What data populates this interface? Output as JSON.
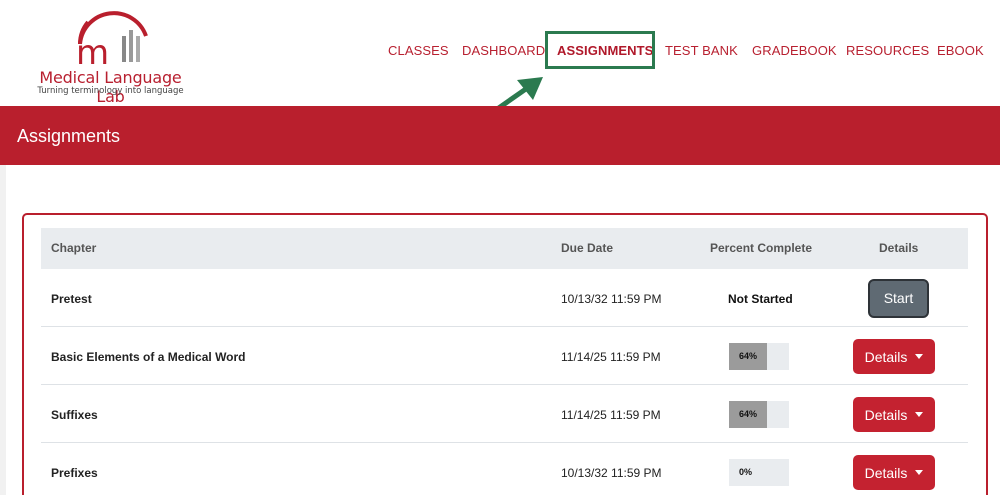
{
  "brand": {
    "name": "Medical Language Lab",
    "tagline": "Turning terminology into language",
    "color": "#b91f2d"
  },
  "nav": {
    "items": [
      "CLASSES",
      "DASHBOARD",
      "ASSIGNMENTS",
      "TEST BANK",
      "GRADEBOOK",
      "RESOURCES",
      "EBOOK"
    ],
    "active": "ASSIGNMENTS"
  },
  "annotation": {
    "highlight_color": "#2b7a4f",
    "arrow_icon": "arrow-up-right-icon"
  },
  "page": {
    "title": "Assignments"
  },
  "table": {
    "headers": {
      "chapter": "Chapter",
      "due": "Due Date",
      "percent": "Percent Complete",
      "details": "Details"
    },
    "rows": [
      {
        "chapter": "Pretest",
        "due": "10/13/32 11:59 PM",
        "status": "Not Started",
        "action": "Start"
      },
      {
        "chapter": "Basic Elements of a Medical Word",
        "due": "11/14/25 11:59 PM",
        "percent": 0.64,
        "percent_label": "64%",
        "action": "Details"
      },
      {
        "chapter": "Suffixes",
        "due": "11/14/25 11:59 PM",
        "percent": 0.64,
        "percent_label": "64%",
        "action": "Details"
      },
      {
        "chapter": "Prefixes",
        "due": "10/13/32 11:59 PM",
        "percent": 0.0,
        "percent_label": "0%",
        "action": "Details"
      }
    ]
  }
}
